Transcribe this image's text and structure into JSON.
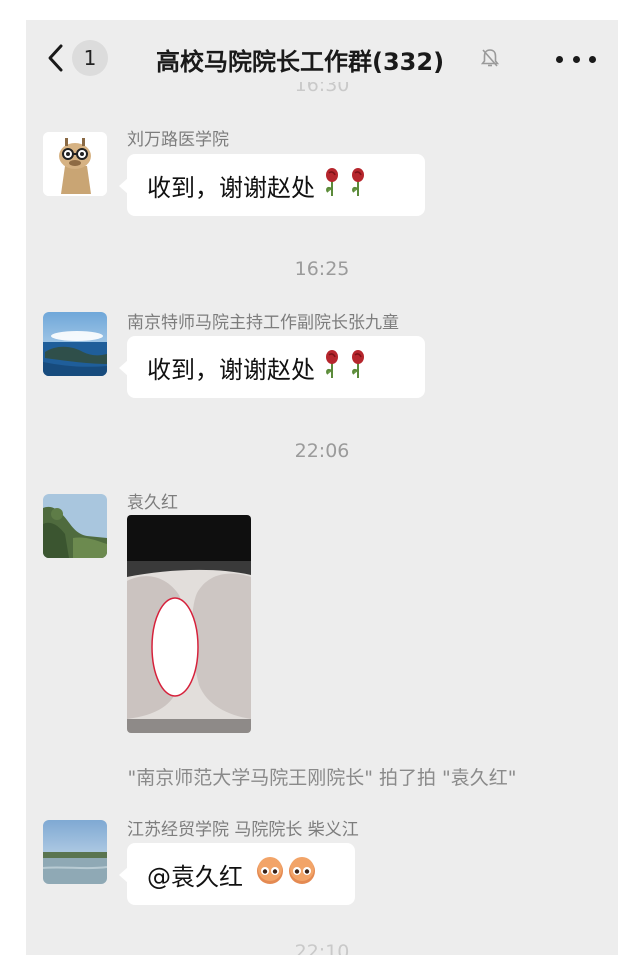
{
  "navbar": {
    "back_count": "1",
    "title": "高校马院院长工作群(332)",
    "icons": {
      "back": "chevron-left-icon",
      "mute": "bell-off-icon",
      "more": "more-dots-icon"
    }
  },
  "messages": {
    "top_time_partial": "16:30",
    "m1": {
      "sender": "刘万路医学院",
      "text": "收到，谢谢赵处",
      "emoji": "rose-icon"
    },
    "time1": "16:25",
    "m2": {
      "sender": "南京特师马院主持工作副院长张九童",
      "text": "收到，谢谢赵处",
      "emoji": "rose-icon"
    },
    "time2": "22:06",
    "m3": {
      "sender": "袁久红",
      "type": "image"
    },
    "pat": "\"南京师范大学马院王刚院长\" 拍了拍 \"袁久红\"",
    "m4": {
      "sender": "江苏经贸学院 马院院长 柴义江",
      "text": "@袁久红",
      "emoji": "face-emoji"
    },
    "bottom_time_partial": "22:10"
  },
  "colors": {
    "chat_background": "#ededed",
    "bubble": "#ffffff",
    "timestamp": "#9b9b9b",
    "sender": "#7d7d7d"
  }
}
